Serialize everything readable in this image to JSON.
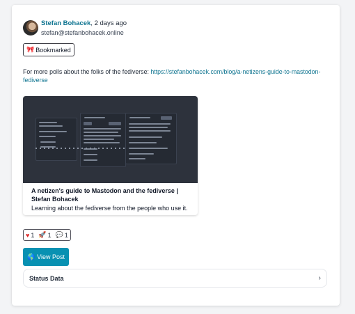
{
  "post": {
    "author_name": "Stefan Bohacek",
    "separator": ", ",
    "timestamp": "2 days ago",
    "handle": "stefan@stefanbohacek.online",
    "badge_icon": "🎀",
    "badge_label": "Bookmarked",
    "text_prefix": "For more polls about the folks of the fediverse: ",
    "text_link": "https://stefanbohacek.com/blog/a-netizens-guide-to-mastodon-fediverse"
  },
  "link_card": {
    "title": "A netizen's guide to Mastodon and the fediverse | Stefan Bohacek",
    "description": "Learning about the fediverse from the people who use it."
  },
  "reactions": [
    {
      "icon": "♥",
      "count": "1",
      "color": "#dc2626"
    },
    {
      "icon": "🚀",
      "count": "1"
    },
    {
      "icon": "💬",
      "count": "1"
    }
  ],
  "actions": {
    "view_icon": "🌎",
    "view_label": "View Post",
    "status_data_label": "Status Data",
    "status_data_icon": "chevron-right-icon"
  },
  "colors": {
    "accent": "#0891b2",
    "link": "#0e7490",
    "preview_bg": "#2d323c"
  }
}
